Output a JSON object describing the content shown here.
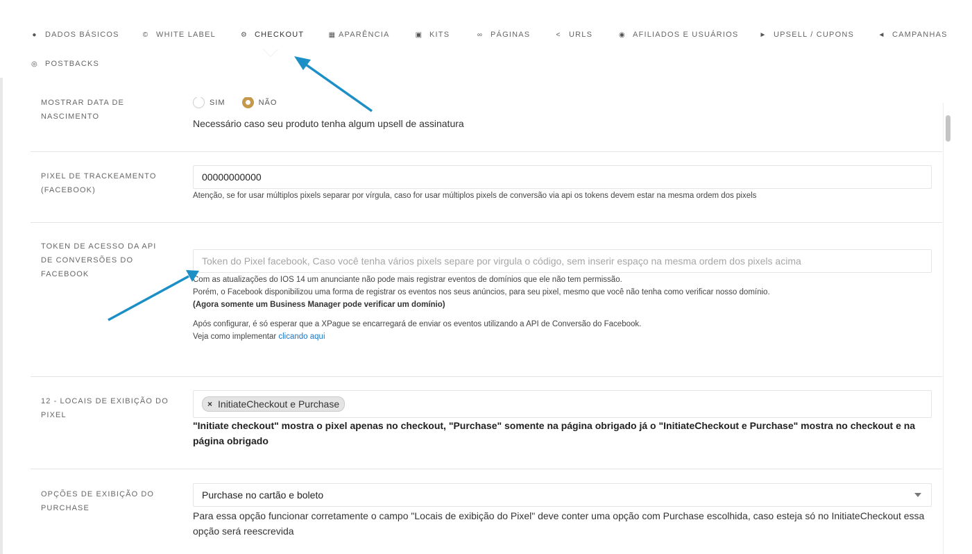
{
  "nav": {
    "tabs": [
      {
        "label": "DADOS BÁSICOS",
        "icon": "info-icon"
      },
      {
        "label": "WHITE LABEL",
        "icon": "copyright-icon"
      },
      {
        "label": "CHECKOUT",
        "icon": "gear-icon",
        "active": true
      },
      {
        "label": "APARÊNCIA",
        "icon": "palette-icon"
      },
      {
        "label": "KITS",
        "icon": "cart-icon"
      },
      {
        "label": "PÁGINAS",
        "icon": "link-icon"
      },
      {
        "label": "URLS",
        "icon": "share-icon"
      },
      {
        "label": "AFILIADOS E USUÁRIOS",
        "icon": "eye-icon"
      },
      {
        "label": "UPSELL / CUPONS",
        "icon": "tag-icon"
      },
      {
        "label": "CAMPANHAS",
        "icon": "megaphone-icon"
      },
      {
        "label": "POSTBACKS",
        "icon": "globe-icon"
      }
    ]
  },
  "fields": {
    "birthdate": {
      "label": "MOSTRAR DATA DE NASCIMENTO",
      "option_yes": "SIM",
      "option_no": "NÃO",
      "selected": "NÃO",
      "help": "Necessário caso seu produto tenha algum upsell de assinatura"
    },
    "pixel": {
      "label": "PIXEL DE TRACKEAMENTO (FACEBOOK)",
      "value": "00000000000",
      "help": "Atenção, se for usar múltiplos pixels separar por vírgula, caso for usar múltiplos pixels de conversão via api os tokens devem estar na mesma ordem dos pixels"
    },
    "token": {
      "label": "TOKEN DE ACESSO DA API DE CONVERSÕES DO FACEBOOK",
      "placeholder": "Token do Pixel facebook, Caso você tenha vários pixels separe por virgula o código, sem inserir espaço na mesma ordem dos pixels acima",
      "help1": "Com as atualizações do IOS 14 um anunciante não pode mais registrar eventos de domínios que ele não tem permissão.",
      "help2": "Porém, o Facebook disponibilizou uma forma de registrar os eventos nos seus anúncios, para seu pixel, mesmo que você não tenha como verificar nosso domínio.",
      "help3": "(Agora somente um Business Manager pode verificar um domínio)",
      "help4": "Após configurar, é só esperar que a XPague se encarregará de enviar os eventos utilizando a API de Conversão do Facebook.",
      "help5_prefix": "Veja como implementar ",
      "help5_link": "clicando aqui"
    },
    "locations": {
      "label": "12 - LOCAIS DE EXIBIÇÃO DO PIXEL",
      "chip_remove": "×",
      "chip": "InitiateCheckout e Purchase",
      "help": "\"Initiate checkout\" mostra o pixel apenas no checkout, \"Purchase\" somente na página obrigado já o \"InitiateCheckout e Purchase\" mostra no checkout e na página obrigado"
    },
    "purchase": {
      "label": "OPÇÕES DE EXIBIÇÃO DO PURCHASE",
      "value": "Purchase no cartão e boleto",
      "help": "Para essa opção funcionar corretamente o campo \"Locais de exibição do Pixel\" deve conter uma opção com Purchase escolhida, caso esteja só no InitiateCheckout essa opção será reescrevida"
    }
  },
  "colors": {
    "accent": "#c49a4a",
    "arrow": "#1b8fc6",
    "link": "#1a76c6"
  }
}
